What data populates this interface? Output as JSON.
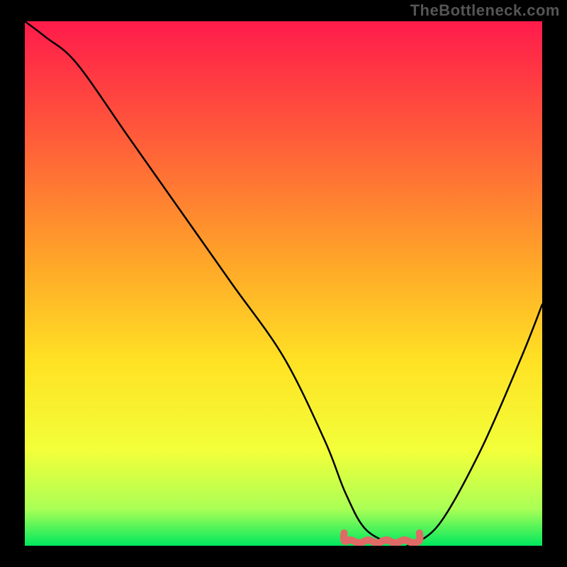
{
  "watermark": "TheBottleneck.com",
  "colors": {
    "frame": "#000000",
    "watermark_text": "#555555",
    "curve": "#000000",
    "optimal_marker": "#e06a66",
    "gradient_stops": [
      {
        "offset": 0.0,
        "color": "#ff1b4b"
      },
      {
        "offset": 0.22,
        "color": "#ff5b3a"
      },
      {
        "offset": 0.45,
        "color": "#ffa329"
      },
      {
        "offset": 0.65,
        "color": "#ffe224"
      },
      {
        "offset": 0.82,
        "color": "#f2ff3a"
      },
      {
        "offset": 0.93,
        "color": "#aaff55"
      },
      {
        "offset": 1.0,
        "color": "#00e85e"
      }
    ]
  },
  "chart_data": {
    "type": "line",
    "title": "",
    "xlabel": "",
    "ylabel": "",
    "xlim": [
      0,
      100
    ],
    "ylim": [
      0,
      100
    ],
    "series": [
      {
        "name": "bottleneck-curve",
        "x": [
          0,
          4,
          10,
          20,
          30,
          40,
          50,
          58,
          62,
          66,
          72,
          74,
          80,
          88,
          96,
          100
        ],
        "values": [
          100,
          97,
          92,
          78,
          64,
          50,
          36,
          20,
          10,
          3,
          0,
          0,
          4,
          18,
          36,
          46
        ]
      }
    ],
    "annotations": [
      {
        "name": "optimal-range",
        "x_start": 62,
        "x_end": 76,
        "y": 0
      }
    ]
  }
}
